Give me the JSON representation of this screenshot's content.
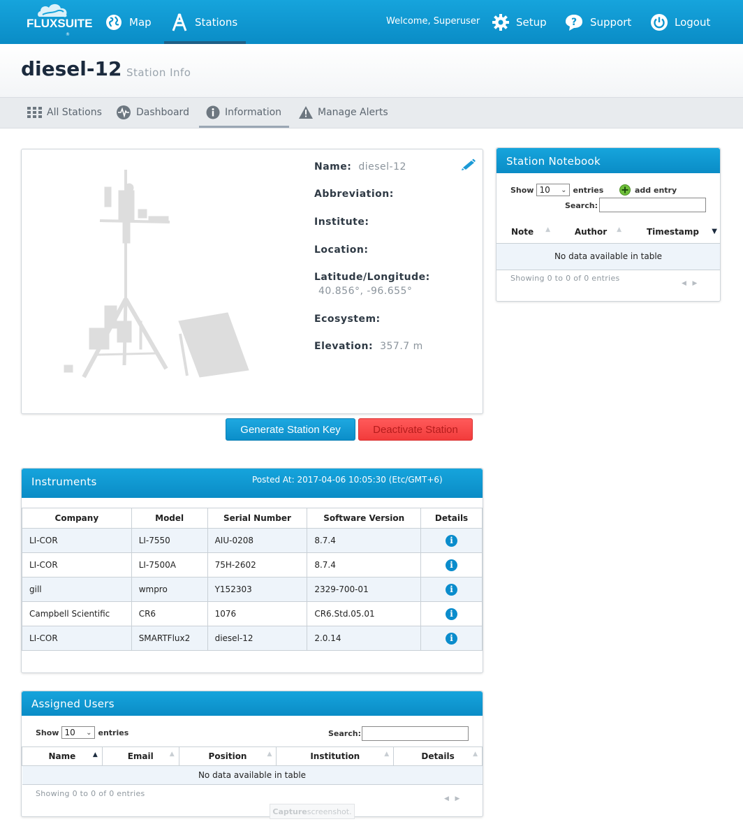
{
  "nav": {
    "logo": "FLUXSUITE",
    "logo_mark": "®",
    "map": "Map",
    "stations": "Stations",
    "welcome": "Welcome, Superuser",
    "setup": "Setup",
    "support": "Support",
    "logout": "Logout"
  },
  "page": {
    "title": "diesel-12",
    "subtitle": "Station Info"
  },
  "subnav": {
    "all_stations": "All Stations",
    "dashboard": "Dashboard",
    "information": "Information",
    "manage_alerts": "Manage Alerts"
  },
  "station": {
    "name_label": "Name:",
    "name_value": "diesel-12",
    "abbreviation_label": "Abbreviation:",
    "institute_label": "Institute:",
    "location_label": "Location:",
    "latlon_label": "Latitude/Longitude:",
    "latlon_value": "40.856°, -96.655°",
    "ecosystem_label": "Ecosystem:",
    "elevation_label": "Elevation:",
    "elevation_value": "357.7 m"
  },
  "buttons": {
    "generate_key": "Generate Station Key",
    "deactivate": "Deactivate Station"
  },
  "instruments": {
    "title": "Instruments",
    "posted_at": "Posted At: 2017-04-06 10:05:30 (Etc/GMT+6)",
    "headers": [
      "Company",
      "Model",
      "Serial Number",
      "Software Version",
      "Details"
    ],
    "rows": [
      [
        "LI-COR",
        "LI-7550",
        "AIU-0208",
        "8.7.4"
      ],
      [
        "LI-COR",
        "LI-7500A",
        "75H-2602",
        "8.7.4"
      ],
      [
        "gill",
        "wmpro",
        "Y152303",
        "2329-700-01"
      ],
      [
        "Campbell Scientific",
        "CR6",
        "1076",
        "CR6.Std.05.01"
      ],
      [
        "LI-COR",
        "SMARTFlux2",
        "diesel-12",
        "2.0.14"
      ]
    ],
    "info_glyph": "i"
  },
  "notebook": {
    "title": "Station Notebook",
    "show": "Show",
    "page_size": "10",
    "entries": "entries",
    "add_entry": "add entry",
    "search": "Search:",
    "headers": [
      "Note",
      "Author",
      "Timestamp"
    ],
    "empty": "No data available in table",
    "showing": "Showing 0 to 0 of 0 entries"
  },
  "users": {
    "title": "Assigned Users",
    "show": "Show",
    "page_size": "10",
    "entries": "entries",
    "search": "Search:",
    "headers": [
      "Name",
      "Email",
      "Position",
      "Institution",
      "Details"
    ],
    "empty": "No data available in table",
    "showing": "Showing 0 to 0 of 0 entries"
  },
  "watermark": {
    "bold": "Capture",
    "rest": " screenshot."
  },
  "colors": {
    "brand_blue": "#0d96cf",
    "danger_red": "#f24545"
  }
}
